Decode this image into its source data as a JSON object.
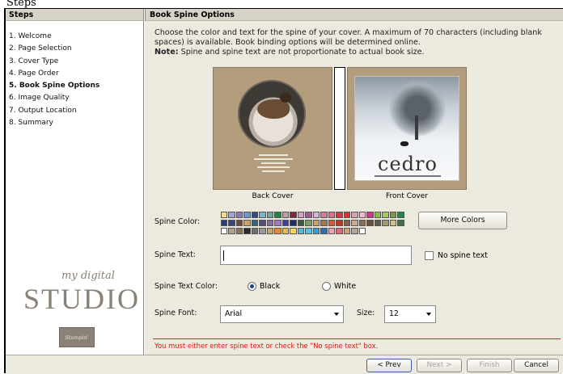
{
  "window": {
    "title": "Steps"
  },
  "sidebar": {
    "header": "Steps",
    "steps": [
      "1. Welcome",
      "2. Page Selection",
      "3. Cover Type",
      "4. Page Order",
      "5. Book Spine Options",
      "6. Image Quality",
      "7. Output Location",
      "8. Summary"
    ],
    "active_index": 4,
    "logo": {
      "script": "my digital",
      "word": "STUDIO",
      "badge": "Stampin' Up!"
    }
  },
  "main": {
    "header": "Book Spine Options",
    "intro": "Choose the color and text for the spine of your cover. A maximum of 70 characters (including blank spaces) is available. Book binding options will be determined online.",
    "note_label": "Note:",
    "note_text": " Spine and spine text are not proportionate to actual book size.",
    "back_cover_label": "Back Cover",
    "front_cover_label": "Front Cover",
    "front_cover_title": "cedro",
    "spine_color_label": "Spine Color:",
    "more_colors_button": "More Colors",
    "spine_text_label": "Spine Text:",
    "spine_text_value": "",
    "no_spine_text_label": "No spine text",
    "spine_text_color_label": "Spine Text Color:",
    "text_color_options": [
      "Black",
      "White"
    ],
    "text_color_selected": "Black",
    "spine_font_label": "Spine Font:",
    "spine_font_value": "Arial",
    "size_label": "Size:",
    "size_value": "12",
    "error": "You must either enter spine text or check the \"No spine text\" box."
  },
  "palette_colors": [
    "#f6d98a",
    "#a3a3d6",
    "#8a7bb8",
    "#6c97c9",
    "#2f4d8d",
    "#7db3cf",
    "#6aa8a0",
    "#2a7d4b",
    "#b7a4a0",
    "#7c2a3c",
    "#d6a0c8",
    "#9c5d8f",
    "#d7b0d6",
    "#d97a9a",
    "#e36b8c",
    "#cc3d4a",
    "#e32c39",
    "#d2a0b0",
    "#f8b7d2",
    "#c63b8c",
    "#82c14b",
    "#a3c863",
    "#7b9b4b",
    "#2e7e4f",
    "#2b3f7a",
    "#36457e",
    "#6a4a38",
    "#c9a36a",
    "#33627a",
    "#5a4a7c",
    "#8a6ba0",
    "#a27ac0",
    "#3d3f9c",
    "#1f2d6b",
    "#3a5d3a",
    "#7a9a66",
    "#c7a26a",
    "#a07a4c",
    "#d45a37",
    "#ba3a2a",
    "#8d5a4e",
    "#cfa98a",
    "#8a6a50",
    "#6a4e3c",
    "#5c5c4c",
    "#a09c6a",
    "#d2c28a",
    "#486b4a",
    "#ffffff",
    "#b5a28a",
    "#8d7456",
    "#2a2a2a",
    "#6f6f6f",
    "#9a9a9a",
    "#caa26c",
    "#e58a3a",
    "#e8b84c",
    "#f6d84e",
    "#58b7d4",
    "#58c1e6",
    "#3c9bd8",
    "#2b6fb4",
    "#f3a0b3",
    "#d86a7c",
    "#d4a070",
    "#b7a59a",
    "#ffffff"
  ],
  "footer": {
    "prev": "< Prev",
    "next": "Next >",
    "finish": "Finish",
    "cancel": "Cancel"
  }
}
